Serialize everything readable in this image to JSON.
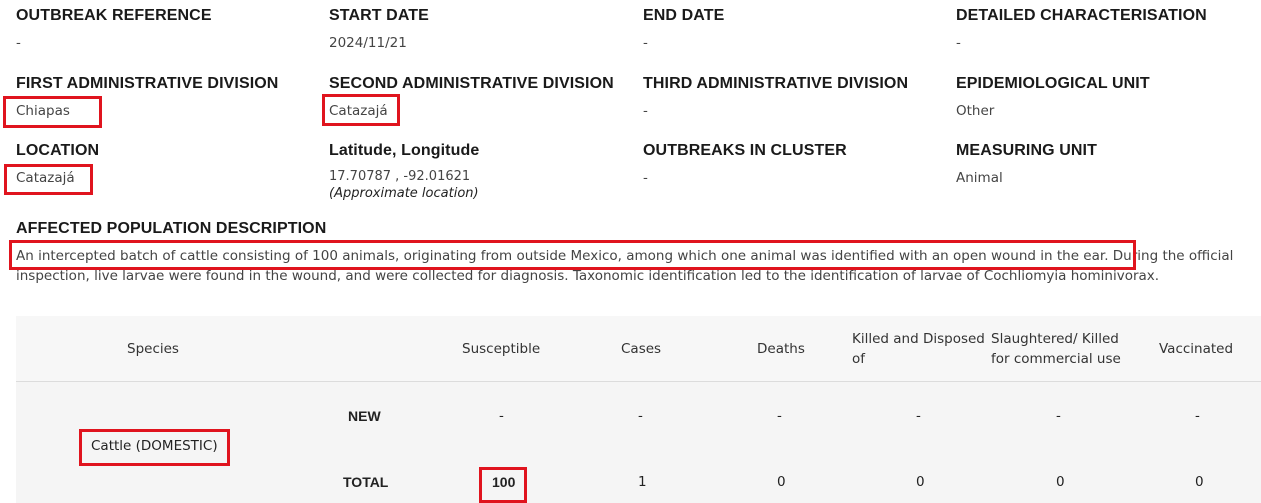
{
  "fields": {
    "outbreak_reference": {
      "label": "OUTBREAK REFERENCE",
      "value": "-"
    },
    "start_date": {
      "label": "START DATE",
      "value": "2024/11/21"
    },
    "end_date": {
      "label": "END DATE",
      "value": "-"
    },
    "detailed_characterisation": {
      "label": "DETAILED CHARACTERISATION",
      "value": "-"
    },
    "first_admin_division": {
      "label": "FIRST ADMINISTRATIVE DIVISION",
      "value": "Chiapas"
    },
    "second_admin_division": {
      "label": "SECOND ADMINISTRATIVE DIVISION",
      "value": "Catazajá"
    },
    "third_admin_division": {
      "label": "THIRD ADMINISTRATIVE DIVISION",
      "value": "-"
    },
    "epidemiological_unit": {
      "label": "EPIDEMIOLOGICAL UNIT",
      "value": "Other"
    },
    "location": {
      "label": "LOCATION",
      "value": "Catazajá"
    },
    "lat_long": {
      "label": "Latitude, Longitude",
      "value": "17.70787 , -92.01621",
      "note": "(Approximate location)"
    },
    "outbreaks_in_cluster": {
      "label": "OUTBREAKS IN CLUSTER",
      "value": "-"
    },
    "measuring_unit": {
      "label": "MEASURING UNIT",
      "value": "Animal"
    }
  },
  "affected_population": {
    "label": "AFFECTED POPULATION DESCRIPTION",
    "text_highlighted": "An intercepted batch of cattle consisting of 100 animals, originating from outside Mexico, among which one animal was identified with an open wound in the ear.",
    "text_rest": " During the official inspection, live larvae were found in the wound, and were collected for diagnosis. Taxonomic identification led to the identification of larvae of Cochliomyia hominivorax."
  },
  "table": {
    "headers": {
      "species": "Species",
      "susceptible": "Susceptible",
      "cases": "Cases",
      "deaths": "Deaths",
      "killed": "Killed and Disposed of",
      "slaughtered": "Slaughtered/ Killed for commercial use",
      "vaccinated": "Vaccinated"
    },
    "species_name": "Cattle (DOMESTIC)",
    "rows": [
      {
        "type": "NEW",
        "susceptible": "-",
        "cases": "-",
        "deaths": "-",
        "killed": "-",
        "slaughtered": "-",
        "vaccinated": "-"
      },
      {
        "type": "TOTAL",
        "susceptible": "100",
        "cases": "1",
        "deaths": "0",
        "killed": "0",
        "slaughtered": "0",
        "vaccinated": "0"
      }
    ]
  },
  "colors": {
    "highlight": "#e0141e",
    "table_bg": "#f7f7f7"
  }
}
